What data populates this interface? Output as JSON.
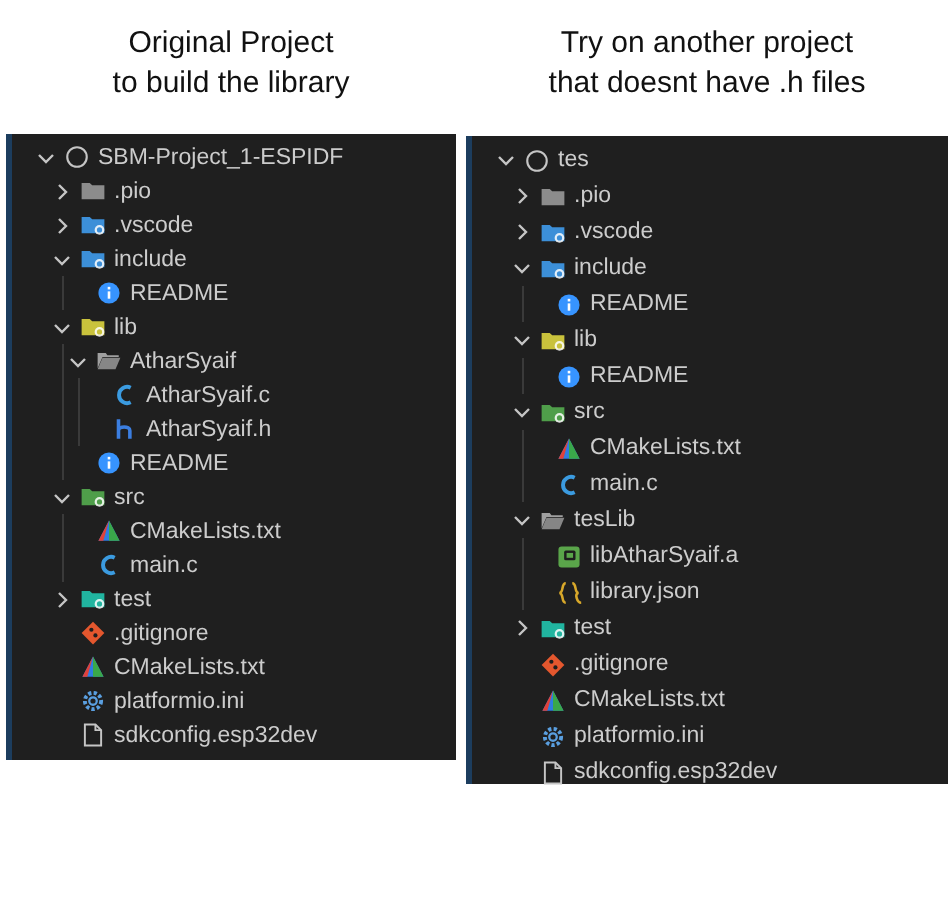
{
  "panels": [
    {
      "caption": [
        "Original Project",
        "to build the library"
      ],
      "tree": {
        "name": "SBM-Project_1-ESPIDF",
        "kind": "root",
        "expanded": true,
        "children": [
          {
            "name": ".pio",
            "kind": "folder",
            "expanded": false
          },
          {
            "name": ".vscode",
            "kind": "vscode",
            "expanded": false
          },
          {
            "name": "include",
            "kind": "include",
            "expanded": true,
            "children": [
              {
                "name": "README",
                "kind": "info"
              }
            ]
          },
          {
            "name": "lib",
            "kind": "lib",
            "expanded": true,
            "children": [
              {
                "name": "AtharSyaif",
                "kind": "open",
                "expanded": true,
                "children": [
                  {
                    "name": "AtharSyaif.c",
                    "kind": "c"
                  },
                  {
                    "name": "AtharSyaif.h",
                    "kind": "h"
                  }
                ]
              },
              {
                "name": "README",
                "kind": "info"
              }
            ]
          },
          {
            "name": "src",
            "kind": "src",
            "expanded": true,
            "children": [
              {
                "name": "CMakeLists.txt",
                "kind": "cmake"
              },
              {
                "name": "main.c",
                "kind": "c"
              }
            ]
          },
          {
            "name": "test",
            "kind": "test",
            "expanded": false
          },
          {
            "name": ".gitignore",
            "kind": "git"
          },
          {
            "name": "CMakeLists.txt",
            "kind": "cmake"
          },
          {
            "name": "platformio.ini",
            "kind": "gear"
          },
          {
            "name": "sdkconfig.esp32dev",
            "kind": "file"
          }
        ]
      }
    },
    {
      "caption": [
        "Try on another project",
        "that doesnt have .h files"
      ],
      "tree": {
        "name": "tes",
        "kind": "root",
        "expanded": true,
        "children": [
          {
            "name": ".pio",
            "kind": "folder",
            "expanded": false
          },
          {
            "name": ".vscode",
            "kind": "vscode",
            "expanded": false
          },
          {
            "name": "include",
            "kind": "include",
            "expanded": true,
            "children": [
              {
                "name": "README",
                "kind": "info"
              }
            ]
          },
          {
            "name": "lib",
            "kind": "lib",
            "expanded": true,
            "children": [
              {
                "name": "README",
                "kind": "info"
              }
            ]
          },
          {
            "name": "src",
            "kind": "src",
            "expanded": true,
            "children": [
              {
                "name": "CMakeLists.txt",
                "kind": "cmake"
              },
              {
                "name": "main.c",
                "kind": "c"
              }
            ]
          },
          {
            "name": "tesLib",
            "kind": "open",
            "expanded": true,
            "children": [
              {
                "name": "libAtharSyaif.a",
                "kind": "archive"
              },
              {
                "name": "library.json",
                "kind": "json"
              }
            ]
          },
          {
            "name": "test",
            "kind": "test",
            "expanded": false
          },
          {
            "name": ".gitignore",
            "kind": "git"
          },
          {
            "name": "CMakeLists.txt",
            "kind": "cmake"
          },
          {
            "name": "platformio.ini",
            "kind": "gear"
          },
          {
            "name": "sdkconfig.esp32dev",
            "kind": "file"
          }
        ]
      }
    }
  ]
}
